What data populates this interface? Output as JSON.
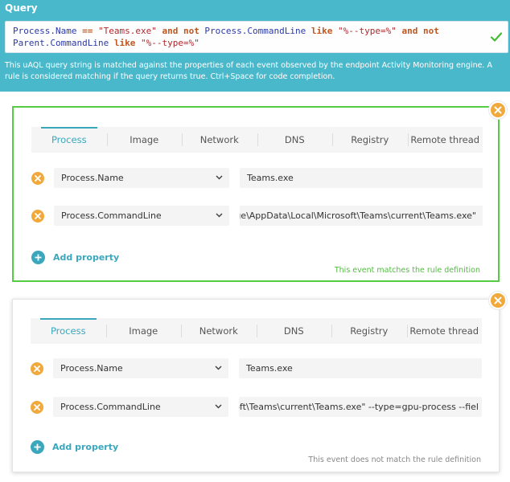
{
  "query": {
    "title": "Query",
    "line1": [
      {
        "t": "Process.Name ",
        "c": "id"
      },
      {
        "t": "==",
        "c": "kw"
      },
      {
        "t": " ",
        "c": "id"
      },
      {
        "t": "\"Teams.exe\"",
        "c": "str"
      },
      {
        "t": " ",
        "c": "id"
      },
      {
        "t": "and not",
        "c": "kw"
      },
      {
        "t": " Process.CommandLine ",
        "c": "id"
      },
      {
        "t": "like",
        "c": "kw"
      },
      {
        "t": " ",
        "c": "id"
      },
      {
        "t": "\"%--type=%\"",
        "c": "str"
      },
      {
        "t": " ",
        "c": "id"
      },
      {
        "t": "and not",
        "c": "kw"
      }
    ],
    "line2": [
      {
        "t": "Parent.CommandLine ",
        "c": "id"
      },
      {
        "t": "like",
        "c": "kw"
      },
      {
        "t": " ",
        "c": "id"
      },
      {
        "t": "\"%--type=%\"",
        "c": "str"
      }
    ],
    "description": "This uAQL query string is matched against the properties of each event observed by the endpoint Activity Monitoring engine. A rule is considered matching if the query returns true. Ctrl+Space for code completion.",
    "valid_icon": "checkmark-icon",
    "accent": "#4ab8cb"
  },
  "tabs": [
    "Process",
    "Image",
    "Network",
    "DNS",
    "Registry",
    "Remote thread"
  ],
  "cards": [
    {
      "active_tab": "Process",
      "properties": [
        {
          "field": "Process.Name",
          "value": "Teams.exe"
        },
        {
          "field": "Process.CommandLine",
          "value": "ers\\helge\\AppData\\Local\\Microsoft\\Teams\\current\\Teams.exe\""
        }
      ],
      "add_label": "Add property",
      "status": "This event matches the rule definition",
      "status_color": "#55bb44"
    },
    {
      "active_tab": "Process",
      "properties": [
        {
          "field": "Process.Name",
          "value": "Teams.exe"
        },
        {
          "field": "Process.CommandLine",
          "value": "\\Microsoft\\Teams\\current\\Teams.exe\" --type=gpu-process --fiel"
        }
      ],
      "add_label": "Add property",
      "status": "This event does not match the rule definition",
      "status_color": "#888888"
    }
  ]
}
